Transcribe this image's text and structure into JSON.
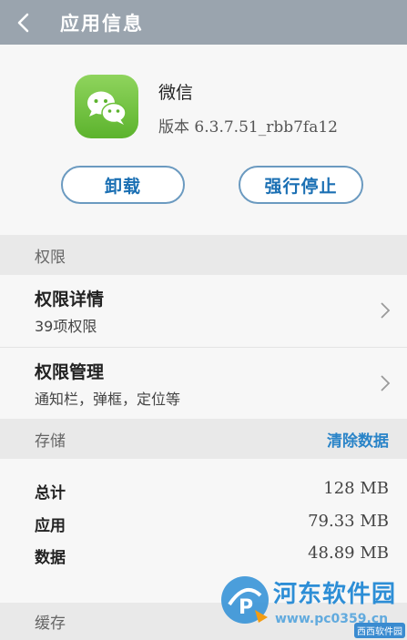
{
  "header": {
    "title": "应用信息",
    "back_icon": "back-arrow-icon"
  },
  "app": {
    "name": "微信",
    "version": "版本 6.3.7.51_rbb7fa12",
    "icon": "wechat-icon",
    "uninstall_label": "卸载",
    "force_stop_label": "强行停止"
  },
  "permissions": {
    "section_label": "权限",
    "items": [
      {
        "title": "权限详情",
        "subtitle": "39项权限"
      },
      {
        "title": "权限管理",
        "subtitle": "通知栏，弹框，定位等"
      }
    ]
  },
  "storage": {
    "section_label": "存储",
    "clear_label": "清除数据",
    "rows": [
      {
        "label": "总计",
        "value": "128 MB"
      },
      {
        "label": "应用",
        "value": "79.33 MB"
      },
      {
        "label": "数据",
        "value": "48.89 MB"
      }
    ]
  },
  "cache": {
    "section_label": "缓存"
  },
  "watermark": {
    "title": "河东软件园",
    "url": "www.pc0359.cn",
    "badge": "西西软件园"
  },
  "colors": {
    "titlebar": "#9aa4ae",
    "accent": "#2a84c8",
    "icon_green": "#6cc13a"
  }
}
